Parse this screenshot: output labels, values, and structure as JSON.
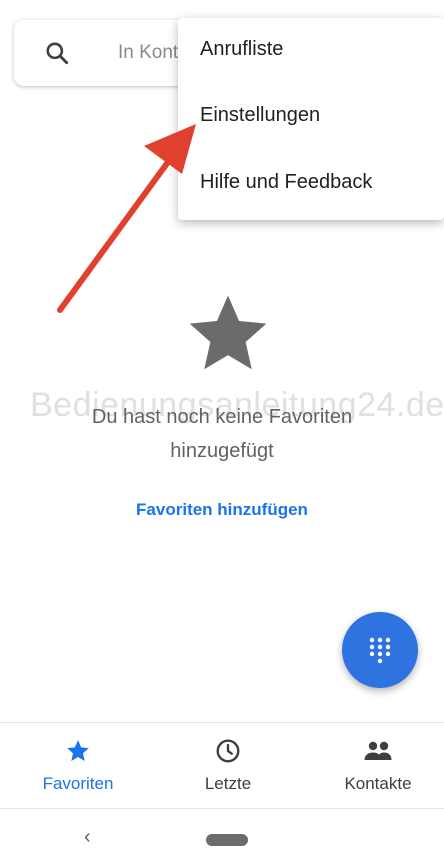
{
  "search": {
    "placeholder": "In Kontakten suchen",
    "visible_text": "In Kont"
  },
  "menu": {
    "items": [
      {
        "label": "Anrufliste"
      },
      {
        "label": "Einstellungen"
      },
      {
        "label": "Hilfe und Feedback"
      }
    ]
  },
  "annotation": {
    "arrow_color": "#e0412f"
  },
  "empty_state": {
    "icon": "star-icon",
    "line1": "Du hast noch keine Favoriten",
    "line2": "hinzugefügt",
    "action": "Favoriten hinzufügen"
  },
  "watermark": "Bedienungsanleitung24.de",
  "fab": {
    "icon": "dialpad-icon",
    "color": "#2f73e0"
  },
  "bottom_nav": {
    "items": [
      {
        "label": "Favoriten",
        "icon": "star-icon",
        "selected": true
      },
      {
        "label": "Letzte",
        "icon": "clock-icon",
        "selected": false
      },
      {
        "label": "Kontakte",
        "icon": "people-icon",
        "selected": false
      }
    ],
    "accent": "#1a73e8"
  },
  "system_nav": {
    "back": "‹"
  }
}
